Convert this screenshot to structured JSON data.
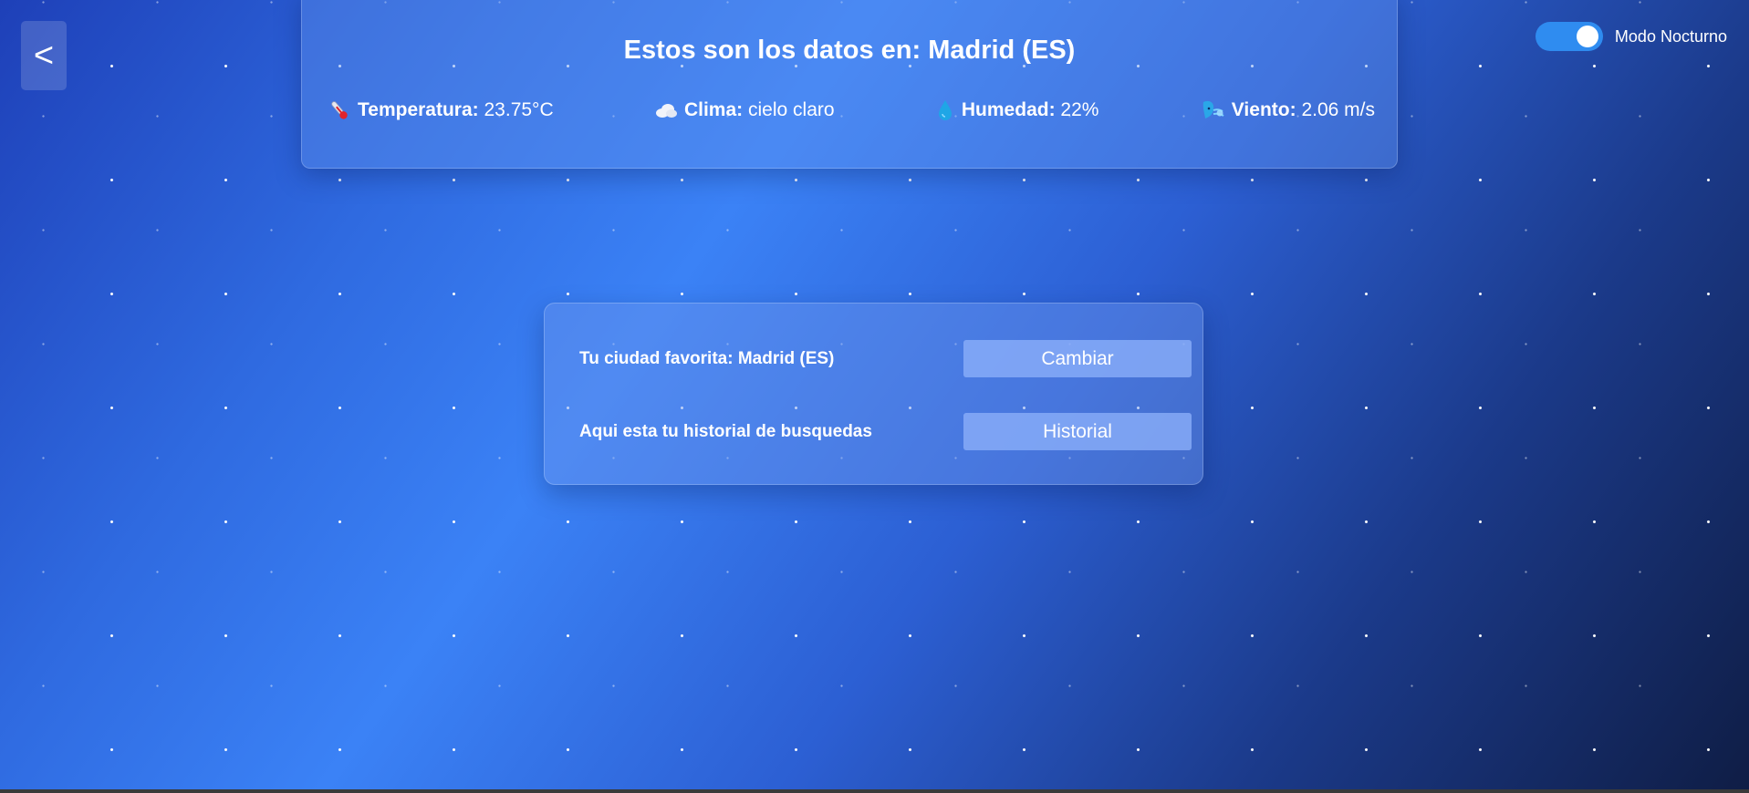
{
  "nav": {
    "back_label": "<"
  },
  "night_mode": {
    "label": "Modo Nocturno",
    "enabled": true
  },
  "weather": {
    "title": "Estos son los datos en: Madrid (ES)",
    "temperature": {
      "icon": "thermometer-icon",
      "label": "Temperatura:",
      "value": "23.75°C"
    },
    "climate": {
      "icon": "cloud-icon",
      "label": "Clima:",
      "value": "cielo claro"
    },
    "humidity": {
      "icon": "water-drop-icon",
      "label": "Humedad:",
      "value": "22%"
    },
    "wind": {
      "icon": "wind-face-icon",
      "label": "Viento:",
      "value": "2.06 m/s"
    }
  },
  "settings": {
    "favorite_text": "Tu ciudad favorita: Madrid (ES)",
    "change_label": "Cambiar",
    "history_text": "Aqui esta tu historial de busquedas",
    "history_label": "Historial"
  },
  "colors": {
    "background_start": "#1e40b8",
    "background_mid": "#3b82f6",
    "background_end": "#0f1d45",
    "toggle_on": "#2f8cf0"
  }
}
